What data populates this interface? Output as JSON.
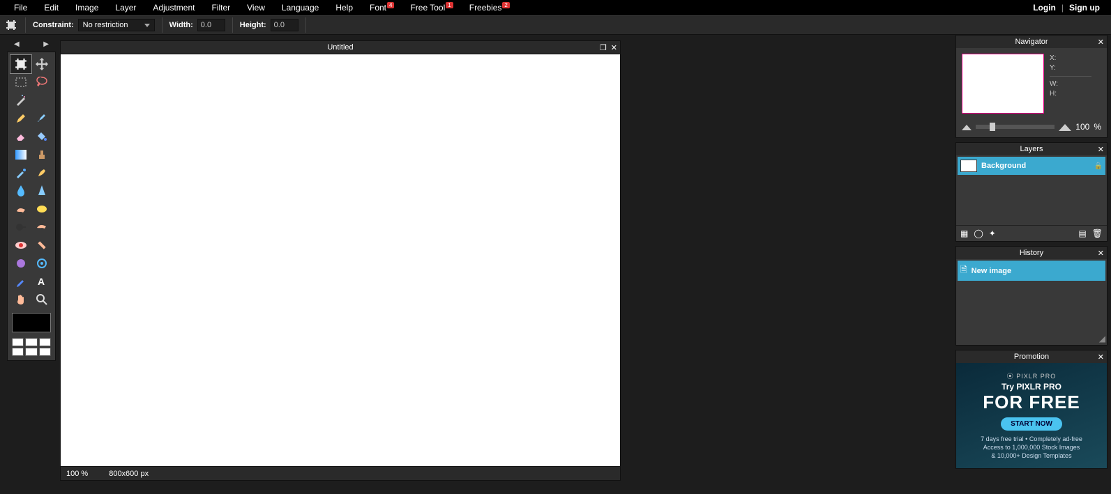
{
  "menu": {
    "items": [
      "File",
      "Edit",
      "Image",
      "Layer",
      "Adjustment",
      "Filter",
      "View",
      "Language",
      "Help",
      "Font",
      "Free Tool",
      "Freebies"
    ],
    "badges": {
      "9": "4",
      "10": "1",
      "11": "2"
    },
    "login": "Login",
    "signup": "Sign up"
  },
  "options": {
    "constraint_label": "Constraint:",
    "constraint_value": "No restriction",
    "width_label": "Width:",
    "width_value": "0.0",
    "height_label": "Height:",
    "height_value": "0.0"
  },
  "canvas": {
    "title": "Untitled",
    "zoom": "100",
    "zoom_unit": "%",
    "dims": "800x600 px"
  },
  "navigator": {
    "title": "Navigator",
    "x": "X:",
    "y": "Y:",
    "w": "W:",
    "h": "H:",
    "zoom": "100",
    "zoom_unit": "%"
  },
  "layers": {
    "title": "Layers",
    "item": "Background"
  },
  "history": {
    "title": "History",
    "item": "New image"
  },
  "promo": {
    "title": "Promotion",
    "logo": "⦿ PIXLR PRO",
    "line1": "Try PIXLR PRO",
    "line2": "FOR FREE",
    "button": "START NOW",
    "sub1": "7 days free trial • Completely ad-free",
    "sub2": "Access to 1,000,000 Stock Images",
    "sub3": "& 10,000+ Design Templates"
  }
}
